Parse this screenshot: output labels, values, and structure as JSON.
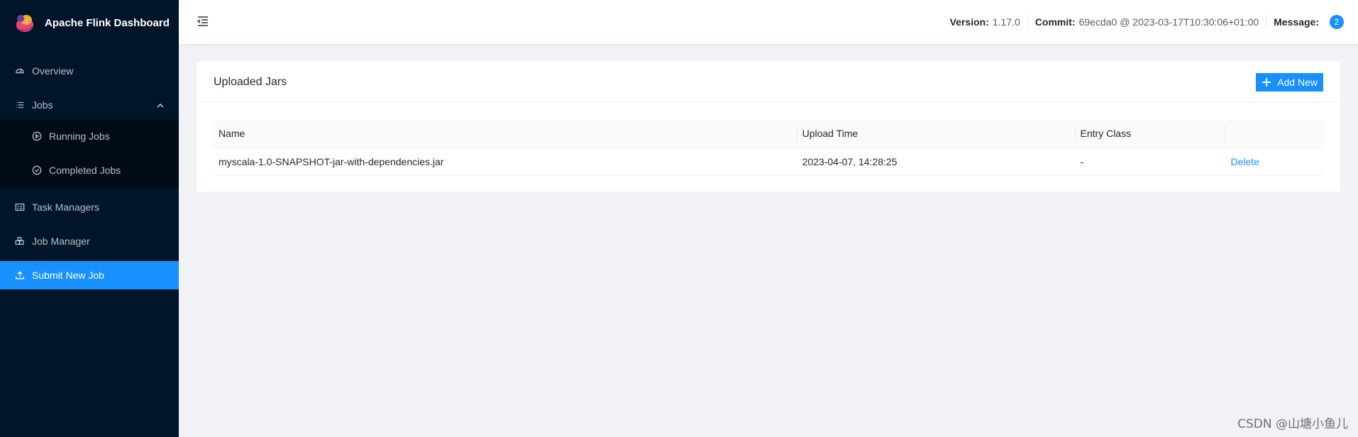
{
  "app": {
    "title": "Apache Flink Dashboard"
  },
  "sidebar": {
    "items": [
      {
        "label": "Overview",
        "icon": "dashboard-icon"
      },
      {
        "label": "Jobs",
        "icon": "list-icon",
        "expanded": true,
        "children": [
          {
            "label": "Running Jobs",
            "icon": "play-circle-icon"
          },
          {
            "label": "Completed Jobs",
            "icon": "check-circle-icon"
          }
        ]
      },
      {
        "label": "Task Managers",
        "icon": "schedule-icon"
      },
      {
        "label": "Job Manager",
        "icon": "build-icon"
      },
      {
        "label": "Submit New Job",
        "icon": "upload-icon",
        "active": true
      }
    ]
  },
  "header": {
    "version_label": "Version:",
    "version_value": "1.17.0",
    "commit_label": "Commit:",
    "commit_value": "69ecda0 @ 2023-03-17T10:30:06+01:00",
    "message_label": "Message:",
    "message_count": "2"
  },
  "card": {
    "title": "Uploaded Jars",
    "add_button": "Add New"
  },
  "table": {
    "columns": [
      "Name",
      "Upload Time",
      "Entry Class",
      ""
    ],
    "rows": [
      {
        "name": "myscala-1.0-SNAPSHOT-jar-with-dependencies.jar",
        "upload_time": "2023-04-07, 14:28:25",
        "entry_class": "-",
        "action": "Delete"
      }
    ]
  },
  "watermark": "CSDN @山塘小鱼儿",
  "colors": {
    "sidebar_bg": "#001529",
    "accent": "#1890ff",
    "submenu_bg": "#000c17"
  }
}
